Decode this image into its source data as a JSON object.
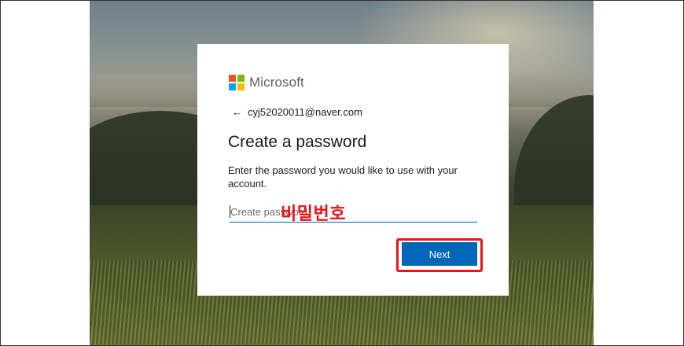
{
  "brand": {
    "name": "Microsoft",
    "logo_colors": [
      "#f25022",
      "#7fba00",
      "#00a4ef",
      "#ffb900"
    ]
  },
  "account": {
    "email": "cyj52020011@naver.com",
    "back_icon": "arrow-left-icon"
  },
  "heading": "Create a password",
  "description": "Enter the password you would like to use with your account.",
  "password_field": {
    "placeholder": "Create password",
    "value": ""
  },
  "annotation": {
    "label": "비밀번호",
    "color": "#e8141b"
  },
  "buttons": {
    "next_label": "Next"
  },
  "colors": {
    "accent": "#0067b8",
    "text": "#1b1b1b"
  }
}
